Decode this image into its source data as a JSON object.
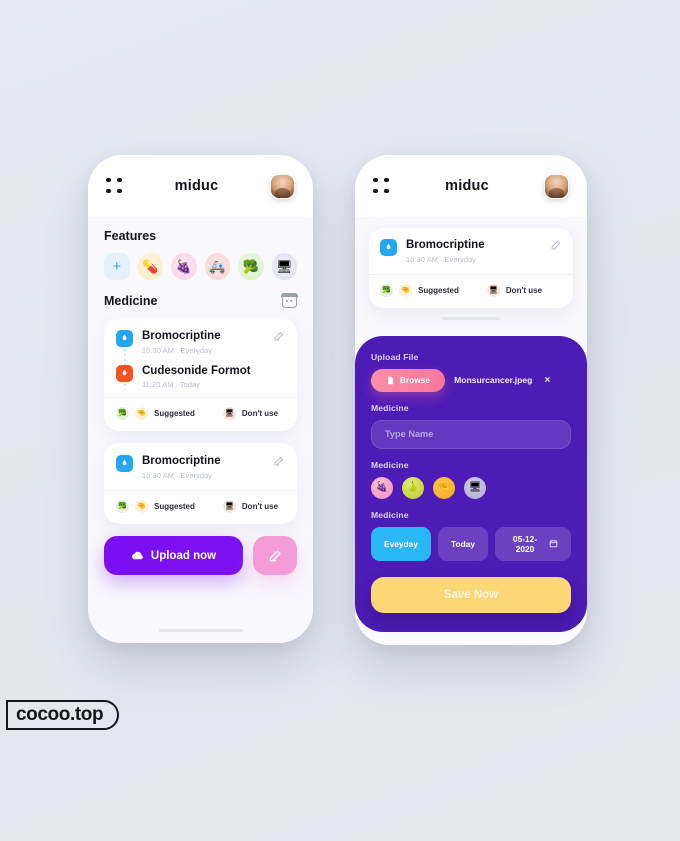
{
  "app": {
    "title": "miduc",
    "watermark": "cocoo.top"
  },
  "left_screen": {
    "menu_icon": "grid-dots-icon",
    "avatar": "user-avatar",
    "features": {
      "heading": "Features",
      "items": [
        {
          "name": "add-feature",
          "glyph": "+"
        },
        {
          "name": "pill-feature",
          "glyph": "💊"
        },
        {
          "name": "grapes-feature",
          "glyph": "🍇"
        },
        {
          "name": "ambulance-feature",
          "glyph": "🚑"
        },
        {
          "name": "broccoli-feature",
          "glyph": "🥦"
        },
        {
          "name": "monitor-feature",
          "glyph": "🖥"
        }
      ]
    },
    "medicine": {
      "heading": "Medicine",
      "calendar_icon": "calendar-icon",
      "card_one": {
        "rows": [
          {
            "name": "Bromocriptine",
            "time": "10:30 AM",
            "freq": "Everyday",
            "color": "blue"
          },
          {
            "name": "Cudesonide Formot",
            "time": "11:20 AM",
            "freq": "Today",
            "color": "orange"
          }
        ],
        "tags": {
          "suggested": "Suggested",
          "dont_use": "Don't use"
        }
      },
      "card_two": {
        "rows": [
          {
            "name": "Bromocriptine",
            "time": "10:30 AM",
            "freq": "Everyday",
            "color": "blue"
          }
        ],
        "tags": {
          "suggested": "Suggested",
          "dont_use": "Don't use"
        }
      }
    },
    "actions": {
      "upload_label": "Upload now",
      "upload_icon": "cloud-upload-icon",
      "edit_icon": "pencil-icon"
    }
  },
  "right_screen": {
    "menu_icon": "grid-dots-icon",
    "avatar": "user-avatar",
    "card": {
      "row": {
        "name": "Bromocriptine",
        "time": "10:30 AM",
        "freq": "Everyday",
        "color": "blue"
      },
      "tags": {
        "suggested": "Suggested",
        "dont_use": "Don't use"
      }
    },
    "form": {
      "upload_label": "Upload File",
      "browse_label": "Browse",
      "browse_icon": "file-icon",
      "file_name": "Monsurcancer.jpeg",
      "remove_icon": "×",
      "name_label": "Medicine",
      "name_placeholder": "Type Name",
      "name_value": "",
      "type_label": "Medicine",
      "types": [
        {
          "name": "grapes-type",
          "glyph": "🍇"
        },
        {
          "name": "pear-type",
          "glyph": "🍐"
        },
        {
          "name": "hand-type",
          "glyph": "🤏"
        },
        {
          "name": "monitor-type",
          "glyph": "🖥"
        }
      ],
      "schedule_label": "Medicine",
      "schedule_chips": [
        {
          "label": "Eveyday",
          "active": true
        },
        {
          "label": "Today",
          "active": false
        },
        {
          "label": "05-12-2020",
          "active": false,
          "icon": "calendar-icon"
        }
      ],
      "save_label": "Save Now"
    }
  },
  "colors": {
    "background": "#e5e8f0",
    "purple_panel": "#4d1bb5",
    "upload_purple": "#7c11f0",
    "pink": "#f49cd8",
    "browse_pink": "#f7779b",
    "save_yellow": "#fbd775",
    "chip_blue": "#2bb7f5",
    "pill_blue": "#22a7f0",
    "pill_orange": "#f4531e"
  }
}
